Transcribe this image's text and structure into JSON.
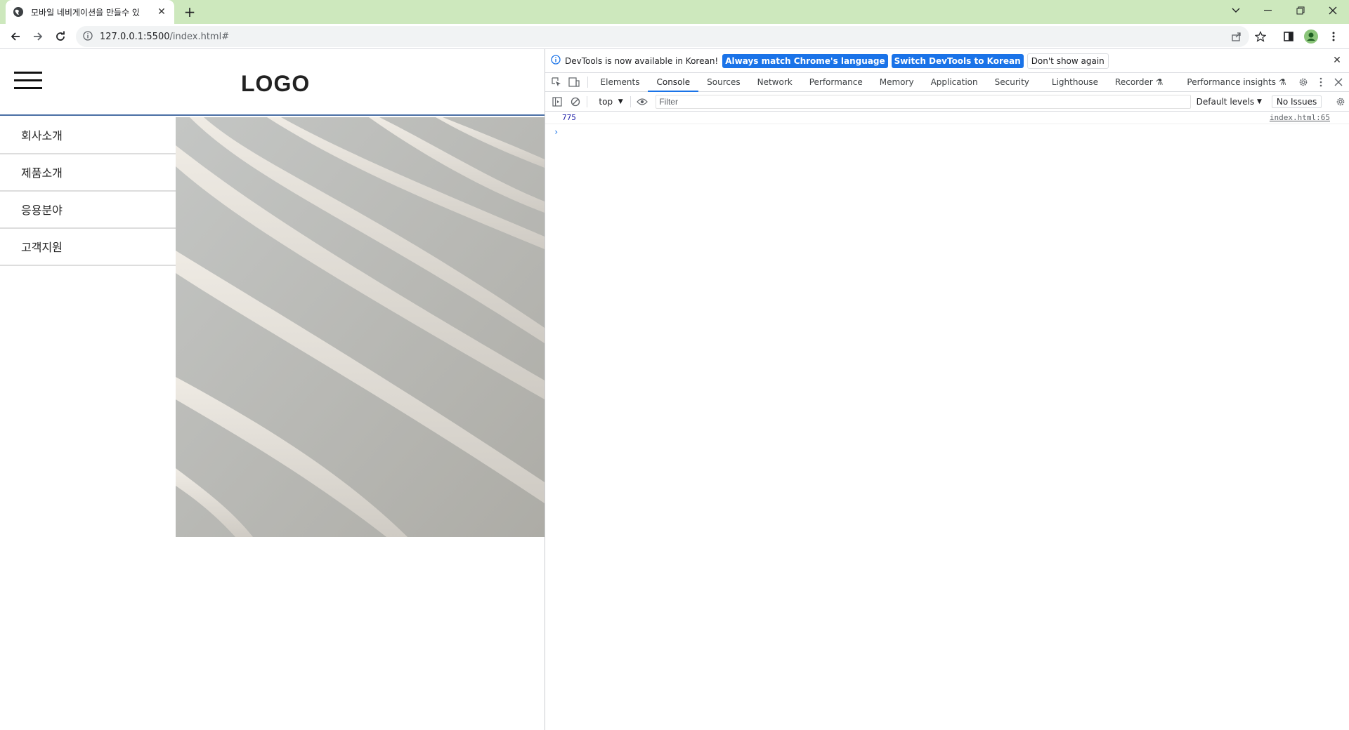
{
  "browser": {
    "tab_title": "모바일 네비게이션을 만들수 있",
    "url_host": "127.0.0.1:5500",
    "url_path": "/index.html#"
  },
  "page": {
    "logo": "LOGO",
    "nav_items": [
      "회사소개",
      "제품소개",
      "응용분야",
      "고객지원"
    ]
  },
  "devtools": {
    "infobar": {
      "text": "DevTools is now available in Korean!",
      "btn_match": "Always match Chrome's language",
      "btn_switch": "Switch DevTools to Korean",
      "btn_dismiss": "Don't show again"
    },
    "tabs": [
      "Elements",
      "Console",
      "Sources",
      "Network",
      "Performance",
      "Memory",
      "Application",
      "Security",
      "Lighthouse",
      "Recorder",
      "Performance insights"
    ],
    "active_tab": "Console",
    "console": {
      "context": "top",
      "filter_placeholder": "Filter",
      "levels": "Default levels",
      "issues": "No Issues",
      "log_value": "775",
      "log_source": "index.html:65"
    }
  },
  "colors": {
    "tabstrip": "#cde8bd",
    "accent": "#1a73e8",
    "header_border": "#4a6fa5"
  }
}
